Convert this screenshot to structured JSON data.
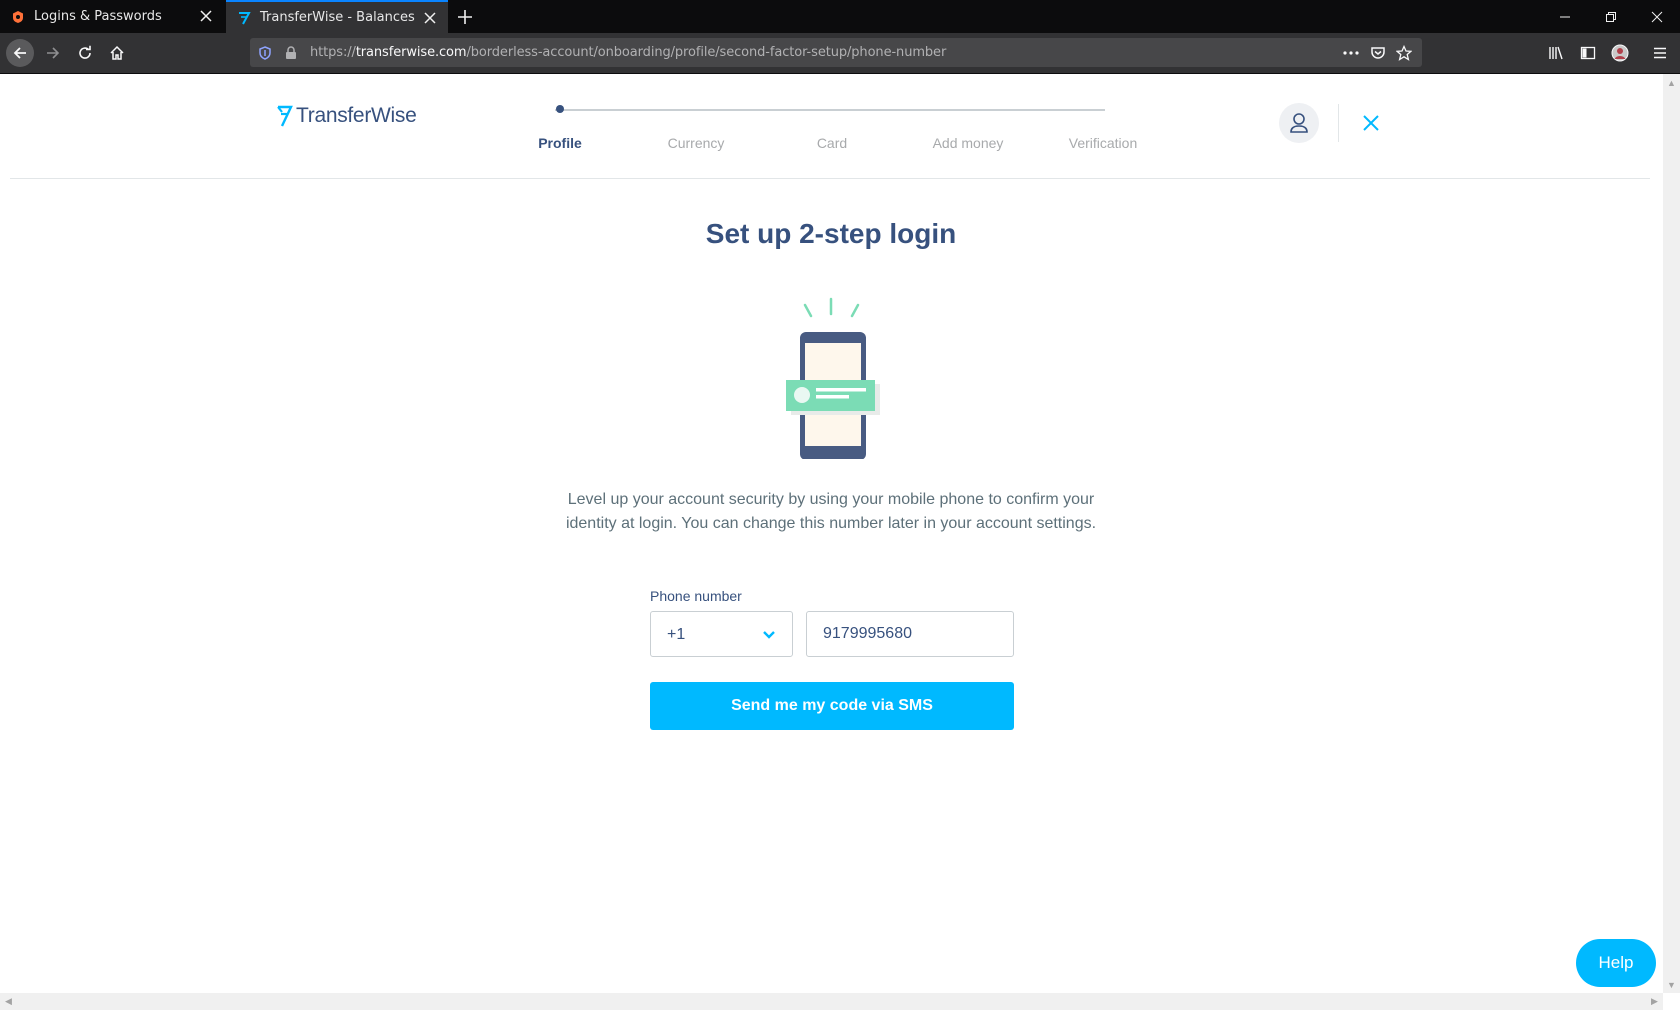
{
  "browser": {
    "tabs": [
      {
        "label": "Logins & Passwords",
        "active": false
      },
      {
        "label": "TransferWise - Balances",
        "active": true
      }
    ],
    "url_scheme": "https://",
    "url_host": "transferwise.com",
    "url_path": "/borderless-account/onboarding/profile/second-factor-setup/phone-number"
  },
  "header": {
    "logo_text": "TransferWise",
    "steps": [
      {
        "label": "Profile",
        "active": true
      },
      {
        "label": "Currency",
        "active": false
      },
      {
        "label": "Card",
        "active": false
      },
      {
        "label": "Add money",
        "active": false
      },
      {
        "label": "Verification",
        "active": false
      }
    ]
  },
  "main": {
    "title": "Set up 2-step login",
    "description": "Level up your account security by using your mobile phone to confirm your identity at login. You can change this number later in your account settings.",
    "phone_label": "Phone number",
    "country_code": "+1",
    "phone_number": "9179995680",
    "submit_label": "Send me my code via SMS"
  },
  "help_label": "Help",
  "colors": {
    "brand_navy": "#37517e",
    "accent_blue": "#00b9ff",
    "illustration_green": "#7bdcb5"
  }
}
